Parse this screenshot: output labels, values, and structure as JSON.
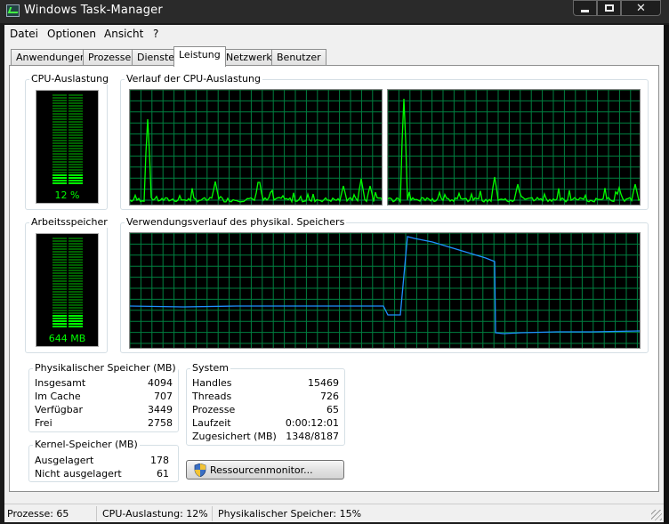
{
  "window": {
    "title": "Windows Task-Manager"
  },
  "menu": [
    "Datei",
    "Optionen",
    "Ansicht",
    "?"
  ],
  "tabs": [
    "Anwendungen",
    "Prozesse",
    "Dienste",
    "Leistung",
    "Netzwerk",
    "Benutzer"
  ],
  "active_tab": "Leistung",
  "cpu": {
    "label": "CPU-Auslastung",
    "value_text": "12 %",
    "percent": 12,
    "history_label": "Verlauf der CPU-Auslastung"
  },
  "memory": {
    "label": "Arbeitsspeicher",
    "value_text": "644 MB",
    "percent": 15,
    "history_label": "Verwendungsverlauf des physikal. Speichers"
  },
  "physical_memory": {
    "title": "Physikalischer Speicher (MB)",
    "rows": [
      {
        "label": "Insgesamt",
        "value": "4094"
      },
      {
        "label": "Im Cache",
        "value": "707"
      },
      {
        "label": "Verfügbar",
        "value": "3449"
      },
      {
        "label": "Frei",
        "value": "2758"
      }
    ]
  },
  "kernel_memory": {
    "title": "Kernel-Speicher (MB)",
    "rows": [
      {
        "label": "Ausgelagert",
        "value": "178"
      },
      {
        "label": "Nicht ausgelagert",
        "value": "61"
      }
    ]
  },
  "system": {
    "title": "System",
    "rows": [
      {
        "label": "Handles",
        "value": "15469"
      },
      {
        "label": "Threads",
        "value": "726"
      },
      {
        "label": "Prozesse",
        "value": "65"
      },
      {
        "label": "Laufzeit",
        "value": "0:00:12:01"
      },
      {
        "label": "Zugesichert (MB)",
        "value": "1348/8187"
      }
    ]
  },
  "resmon_button": "Ressourcenmonitor...",
  "status": {
    "processes": "Prozesse: 65",
    "cpu": "CPU-Auslastung: 12%",
    "memory": "Physikalischer Speicher: 15%"
  },
  "colors": {
    "graph_bg": "#000000",
    "grid": "#008040",
    "cpu_line": "#00ff00",
    "mem_line": "#1e90ff",
    "meter_on": "#00ff00",
    "meter_off": "#006000"
  }
}
